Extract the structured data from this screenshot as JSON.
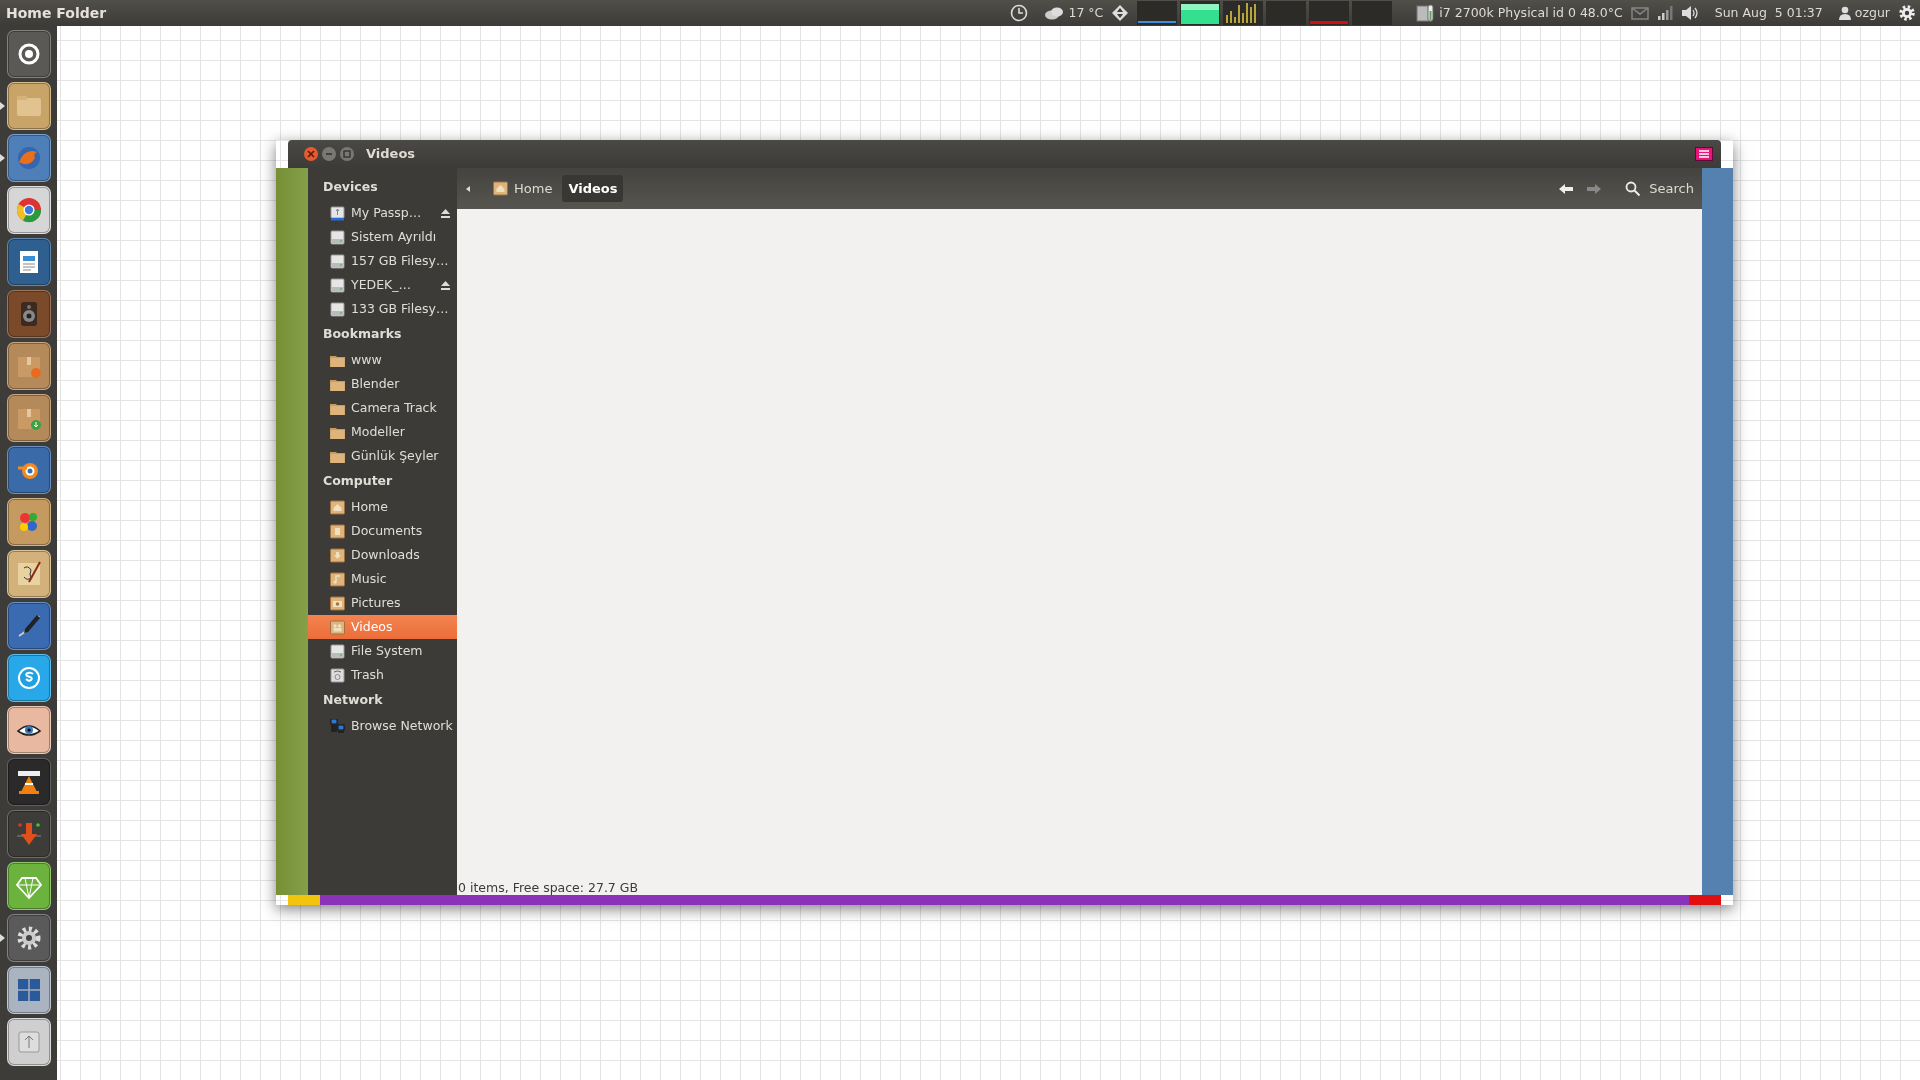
{
  "top_panel": {
    "app_title": "Home Folder",
    "weather": "17 °C",
    "cpu_temperature": "i7 2700k Physical id 0 48.0°C",
    "clock": "Sun Aug  5 01:37",
    "user": "ozgur"
  },
  "launcher": [
    {
      "kind": "dash",
      "running": false
    },
    {
      "kind": "files",
      "running": true
    },
    {
      "kind": "browser-fox",
      "running": true
    },
    {
      "kind": "browser-ring",
      "running": false
    },
    {
      "kind": "writer",
      "running": false
    },
    {
      "kind": "speaker",
      "running": false
    },
    {
      "kind": "package-gear",
      "running": false
    },
    {
      "kind": "package-down",
      "running": false
    },
    {
      "kind": "blender",
      "running": false
    },
    {
      "kind": "paint",
      "running": false
    },
    {
      "kind": "sketch",
      "running": false
    },
    {
      "kind": "pen",
      "running": false
    },
    {
      "kind": "chat",
      "running": false
    },
    {
      "kind": "eye",
      "running": false
    },
    {
      "kind": "cone",
      "running": false
    },
    {
      "kind": "download",
      "running": false
    },
    {
      "kind": "gem",
      "running": false
    },
    {
      "kind": "settings",
      "running": true
    },
    {
      "kind": "workspaces",
      "running": false
    },
    {
      "kind": "usb",
      "running": false
    }
  ],
  "window": {
    "title": "Videos",
    "breadcrumbs": [
      {
        "label": "Home",
        "selected": false
      },
      {
        "label": "Videos",
        "selected": true
      }
    ],
    "search": "Search",
    "sidebar": [
      {
        "heading": "Devices",
        "items": [
          {
            "label": "My Passp…",
            "kind": "usb-drive",
            "eject": true,
            "selected": false
          },
          {
            "label": "Sistem Ayrıldı",
            "kind": "drive",
            "eject": false,
            "selected": false
          },
          {
            "label": "157 GB Filesy…",
            "kind": "drive",
            "eject": false,
            "selected": false
          },
          {
            "label": "YEDEK_…",
            "kind": "drive",
            "eject": true,
            "selected": false
          },
          {
            "label": "133 GB Filesy…",
            "kind": "drive",
            "eject": false,
            "selected": false
          }
        ]
      },
      {
        "heading": "Bookmarks",
        "items": [
          {
            "label": "www",
            "kind": "folder",
            "eject": false,
            "selected": false
          },
          {
            "label": "Blender",
            "kind": "folder",
            "eject": false,
            "selected": false
          },
          {
            "label": "Camera Track",
            "kind": "folder",
            "eject": false,
            "selected": false
          },
          {
            "label": "Modeller",
            "kind": "folder",
            "eject": false,
            "selected": false
          },
          {
            "label": "Günlük Şeyler",
            "kind": "folder",
            "eject": false,
            "selected": false
          }
        ]
      },
      {
        "heading": "Computer",
        "items": [
          {
            "label": "Home",
            "kind": "home",
            "eject": false,
            "selected": false
          },
          {
            "label": "Documents",
            "kind": "documents",
            "eject": false,
            "selected": false
          },
          {
            "label": "Downloads",
            "kind": "downloads",
            "eject": false,
            "selected": false
          },
          {
            "label": "Music",
            "kind": "music",
            "eject": false,
            "selected": false
          },
          {
            "label": "Pictures",
            "kind": "pictures",
            "eject": false,
            "selected": false
          },
          {
            "label": "Videos",
            "kind": "videos",
            "eject": false,
            "selected": true
          },
          {
            "label": "File System",
            "kind": "drive",
            "eject": false,
            "selected": false
          },
          {
            "label": "Trash",
            "kind": "trash",
            "eject": false,
            "selected": false
          }
        ]
      },
      {
        "heading": "Network",
        "items": [
          {
            "label": "Browse Network",
            "kind": "network",
            "eject": false,
            "selected": false
          }
        ]
      }
    ],
    "status": "0 items, Free space: 27.7 GB"
  }
}
